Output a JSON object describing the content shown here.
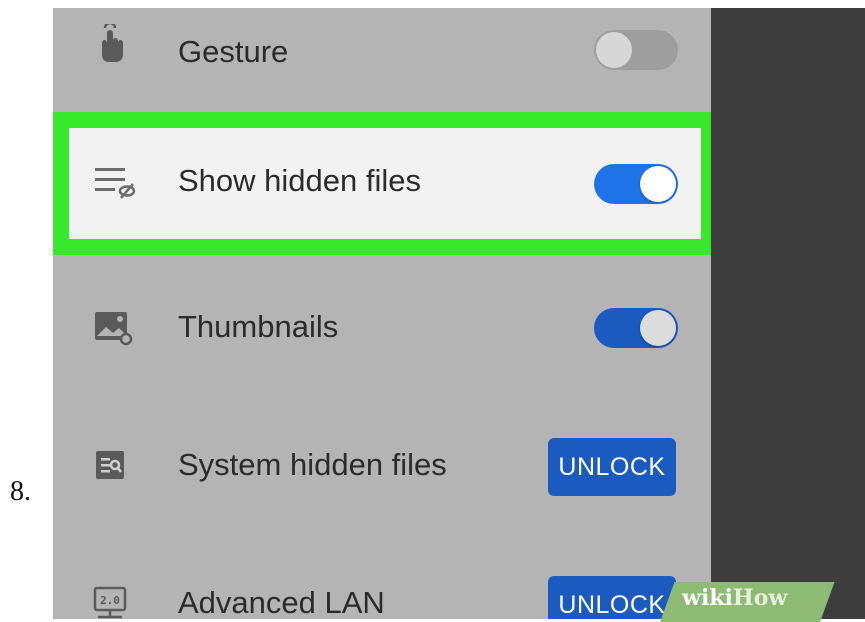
{
  "step_number": "8.",
  "colors": {
    "accent_green": "#37e82b",
    "toggle_on": "#1e73e8",
    "toggle_on_dimmed": "#1b5bbf",
    "toggle_off": "#9e9e9e",
    "unlock_button": "#1b5bbf",
    "panel_background": "#b4b4b4",
    "highlighted_row_background": "#f2f2f2",
    "dim_overlay": "#3d3d3d"
  },
  "settings": {
    "gesture": {
      "label": "Gesture",
      "icon": "gesture-hand-icon",
      "state": "off"
    },
    "show_hidden_files": {
      "label": "Show hidden files",
      "icon": "hidden-files-icon",
      "state": "on",
      "highlighted": true
    },
    "thumbnails": {
      "label": "Thumbnails",
      "icon": "thumbnails-image-icon",
      "state": "on"
    },
    "system_hidden_files": {
      "label": "System hidden files",
      "icon": "system-files-icon",
      "button_label": "UNLOCK"
    },
    "advanced_lan": {
      "label": "Advanced LAN",
      "icon": "lan-2-0-icon",
      "icon_text": "2.0",
      "button_label": "UNLOCK"
    }
  },
  "watermark": {
    "part1": "wiki",
    "part2": "How"
  }
}
